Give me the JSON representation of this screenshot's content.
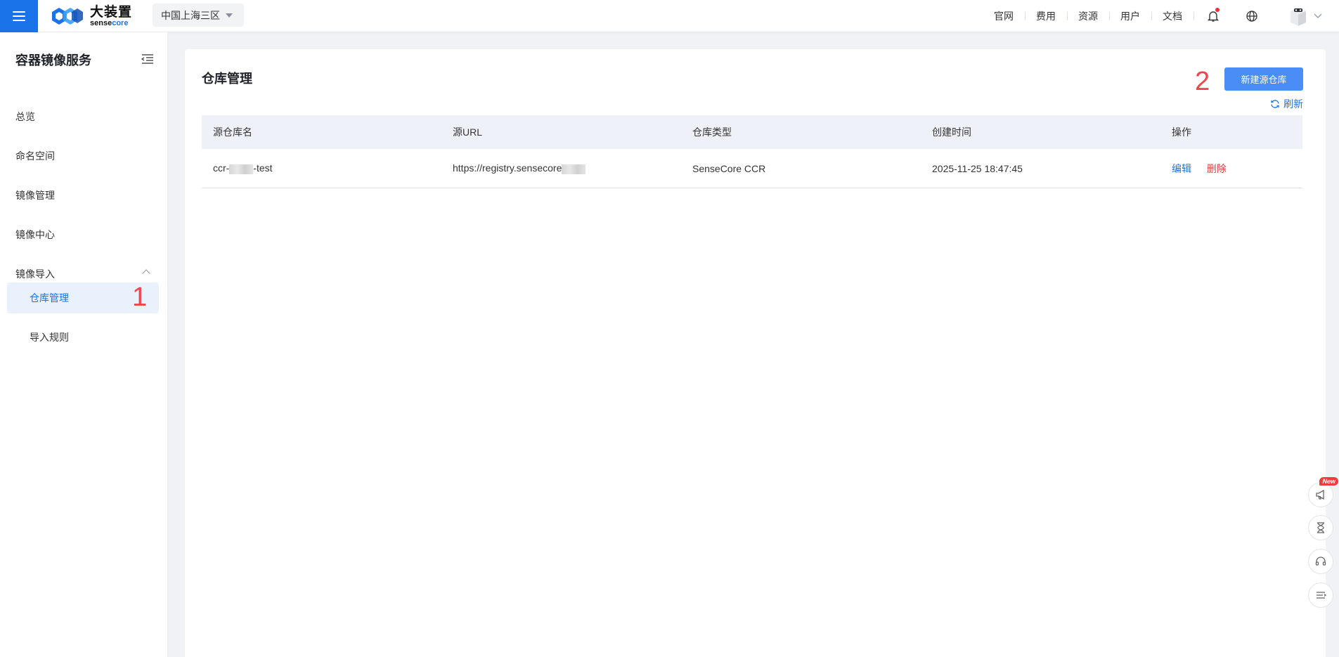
{
  "header": {
    "logo_cn": "大装置",
    "logo_en_a": "sense",
    "logo_en_b": "core",
    "region": "中国上海三区",
    "links": [
      "官网",
      "费用",
      "资源",
      "用户",
      "文档"
    ]
  },
  "sidebar": {
    "title": "容器镜像服务",
    "items": [
      {
        "label": "总览"
      },
      {
        "label": "命名空间"
      },
      {
        "label": "镜像管理"
      },
      {
        "label": "镜像中心"
      },
      {
        "label": "镜像导入"
      },
      {
        "label": "仓库管理"
      },
      {
        "label": "导入规则"
      }
    ]
  },
  "annotations": {
    "one": "1",
    "two": "2"
  },
  "main": {
    "title": "仓库管理",
    "new_button": "新建源仓库",
    "refresh": "刷新",
    "columns": [
      "源仓库名",
      "源URL",
      "仓库类型",
      "创建时间",
      "操作"
    ],
    "rows": [
      {
        "name_prefix": "ccr-",
        "name_suffix": "-test",
        "url": "https://registry.sensecore",
        "type": "SenseCore CCR",
        "created": "2025-11-25 18:47:45",
        "edit": "编辑",
        "delete": "删除"
      }
    ]
  },
  "float_tools": {
    "new_badge": "New"
  },
  "colors": {
    "primary": "#1a73e8",
    "button": "#4a8df6",
    "danger": "#e4393c",
    "annotation": "#f0454a"
  }
}
